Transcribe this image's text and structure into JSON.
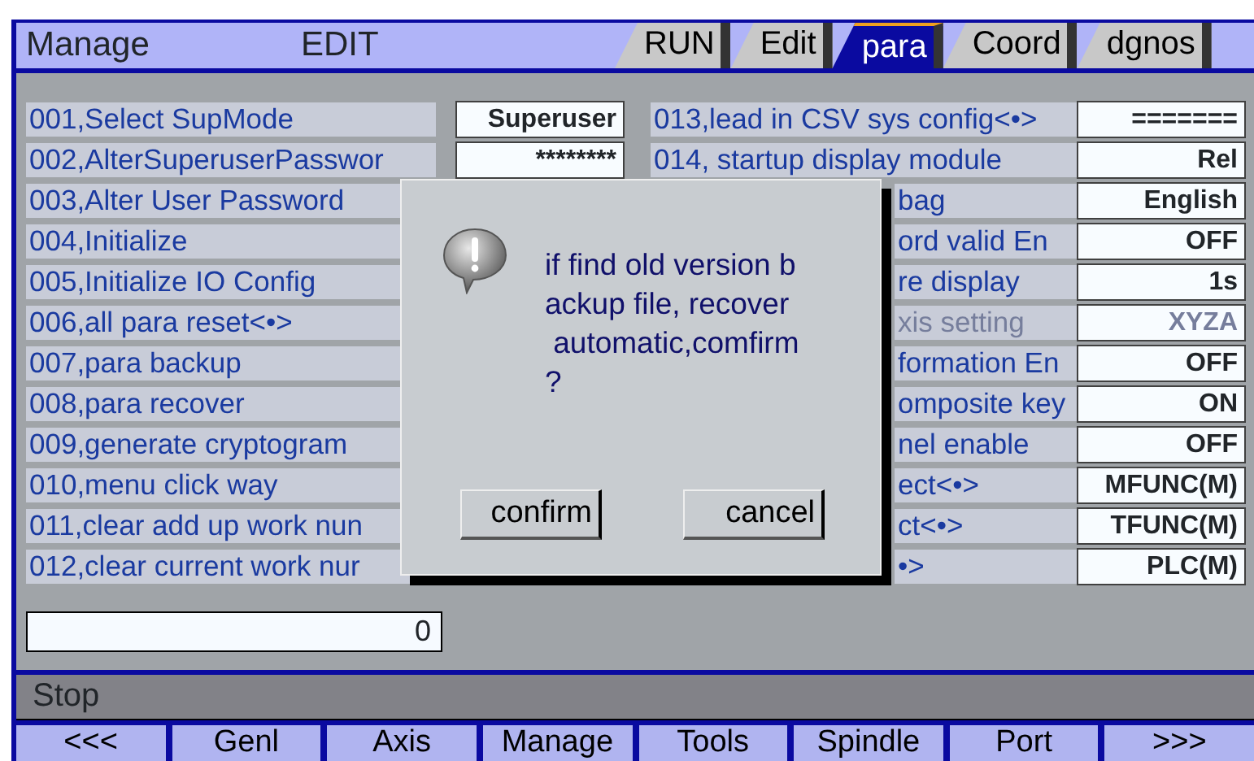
{
  "header": {
    "title": "Manage",
    "mode": "EDIT"
  },
  "tabs": [
    {
      "label": "RUN",
      "selected": false
    },
    {
      "label": "Edit",
      "selected": false
    },
    {
      "label": "para",
      "selected": true
    },
    {
      "label": "Coord",
      "selected": false
    },
    {
      "label": "dgnos",
      "selected": false
    }
  ],
  "left_params": [
    {
      "label": "001,Select SupMode",
      "value": "Superuser"
    },
    {
      "label": "002,AlterSuperuserPasswor",
      "value": "********"
    },
    {
      "label": "003,Alter User Password"
    },
    {
      "label": "004,Initialize"
    },
    {
      "label": "005,Initialize IO Config"
    },
    {
      "label": "006,all para reset<•>"
    },
    {
      "label": "007,para backup"
    },
    {
      "label": "008,para recover"
    },
    {
      "label": "009,generate cryptogram"
    },
    {
      "label": "010,menu click way"
    },
    {
      "label": "011,clear add up work nun"
    },
    {
      "label": "012,clear current work nur"
    }
  ],
  "right_params": [
    {
      "label": "013,lead in CSV sys config<•>",
      "value": "=======",
      "disabled": false,
      "covered": false
    },
    {
      "label": "014, startup display module",
      "value": "Rel",
      "disabled": false,
      "covered": false
    },
    {
      "label": "bag",
      "value": "English",
      "disabled": false,
      "covered": true
    },
    {
      "label": "ord valid En",
      "value": "OFF",
      "disabled": false,
      "covered": true
    },
    {
      "label": "re display",
      "value": "1s",
      "disabled": false,
      "covered": true
    },
    {
      "label": "xis setting",
      "value": "XYZA",
      "disabled": true,
      "covered": true
    },
    {
      "label": "formation En",
      "value": "OFF",
      "disabled": false,
      "covered": true
    },
    {
      "label": "omposite key",
      "value": "ON",
      "disabled": false,
      "covered": true
    },
    {
      "label": "nel enable",
      "value": "OFF",
      "disabled": false,
      "covered": true
    },
    {
      "label": "ect<•>",
      "value": "MFUNC(M)",
      "disabled": false,
      "covered": true
    },
    {
      "label": "ct<•>",
      "value": "TFUNC(M)",
      "disabled": false,
      "covered": true
    },
    {
      "label": "•>",
      "value": "PLC(M)",
      "disabled": false,
      "covered": true
    }
  ],
  "input": {
    "value": "0"
  },
  "dialog": {
    "message": [
      "if find old version b",
      "ackup file, recover",
      " automatic,comfirm",
      "?"
    ],
    "buttons": [
      "confirm",
      "cancel"
    ]
  },
  "status_bar": "Stop",
  "softkeys": [
    "<<<",
    "Genl",
    "Axis",
    "Manage",
    "Tools",
    "Spindle",
    "Port",
    ">>>"
  ]
}
